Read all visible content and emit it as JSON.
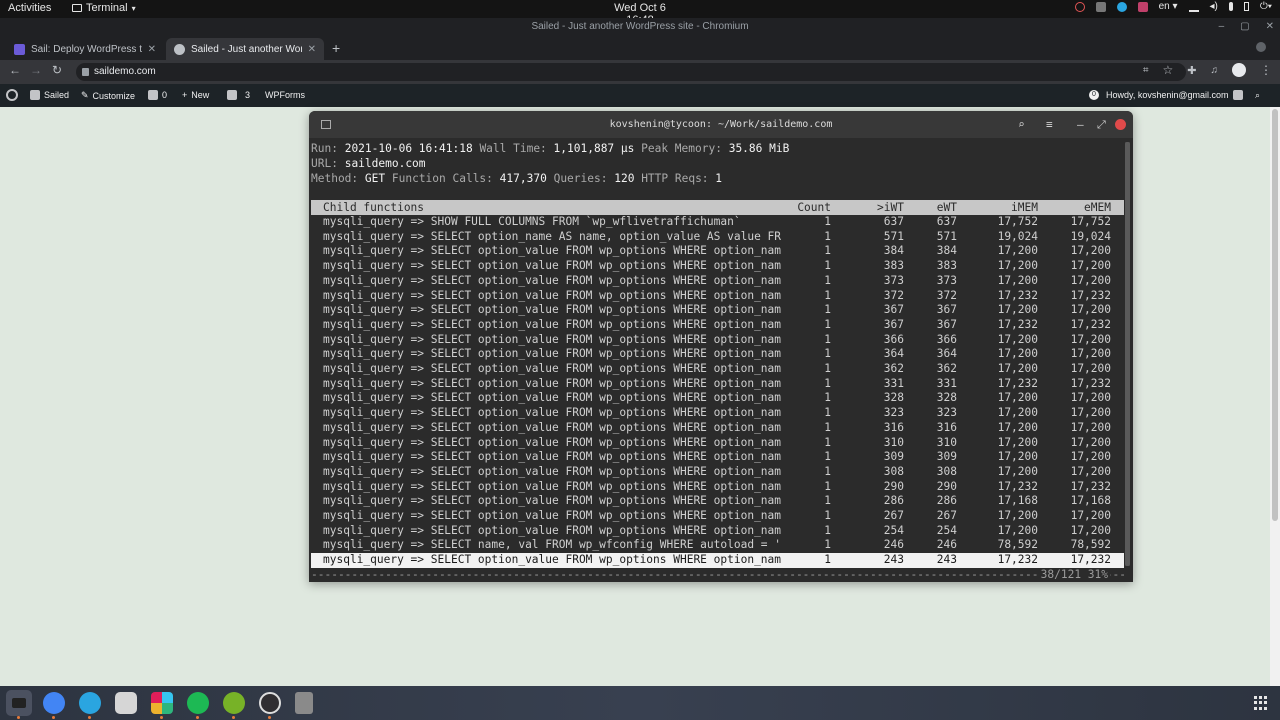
{
  "topbar": {
    "activities": "Activities",
    "app_menu": "Terminal",
    "clock": "Wed Oct 6  16:48",
    "input_source": "en"
  },
  "browser": {
    "window_title": "Sailed - Just another WordPress site - Chromium",
    "tabs": [
      {
        "label": "Sail: Deploy WordPress to",
        "active": false
      },
      {
        "label": "Sailed - Just another Wor",
        "active": true
      }
    ],
    "url": "saildemo.com"
  },
  "wp_admin_bar": {
    "site_name": "Sailed",
    "customize": "Customize",
    "comments_count": "0",
    "new": "New",
    "updates_count": "3",
    "wpforms": "WPForms",
    "notification_count": "0",
    "howdy": "Howdy, kovshenin@gmail.com"
  },
  "terminal": {
    "title": "kovshenin@tycoon: ~/Work/saildemo.com",
    "info": {
      "run_label": "Run:",
      "run": "2021-10-06 16:41:18",
      "wall_label": "Wall Time:",
      "wall": "1,101,887 μs",
      "peak_label": "Peak Memory:",
      "peak": "35.86 MiB",
      "url_label": "URL:",
      "url": "saildemo.com",
      "method_label": "Method:",
      "method": "GET",
      "calls_label": "Function Calls:",
      "calls": "417,370",
      "queries_label": "Queries:",
      "queries": "120",
      "http_label": "HTTP Reqs:",
      "http": "1"
    },
    "columns": {
      "fn": "Child functions",
      "count": "Count",
      "iwt": ">iWT",
      "ewt": "eWT",
      "imem": "iMEM",
      "emem": "eMEM"
    },
    "rows": [
      {
        "fn": "mysqli_query => SHOW FULL COLUMNS FROM `wp_wflivetraffichuman`",
        "count": "1",
        "iwt": "637",
        "ewt": "637",
        "imem": "17,752",
        "emem": "17,752"
      },
      {
        "fn": "mysqli_query => SELECT option_name AS name, option_value AS value FR",
        "count": "1",
        "iwt": "571",
        "ewt": "571",
        "imem": "19,024",
        "emem": "19,024"
      },
      {
        "fn": "mysqli_query => SELECT option_value FROM wp_options WHERE option_nam",
        "count": "1",
        "iwt": "384",
        "ewt": "384",
        "imem": "17,200",
        "emem": "17,200"
      },
      {
        "fn": "mysqli_query => SELECT option_value FROM wp_options WHERE option_nam",
        "count": "1",
        "iwt": "383",
        "ewt": "383",
        "imem": "17,200",
        "emem": "17,200"
      },
      {
        "fn": "mysqli_query => SELECT option_value FROM wp_options WHERE option_nam",
        "count": "1",
        "iwt": "373",
        "ewt": "373",
        "imem": "17,200",
        "emem": "17,200"
      },
      {
        "fn": "mysqli_query => SELECT option_value FROM wp_options WHERE option_nam",
        "count": "1",
        "iwt": "372",
        "ewt": "372",
        "imem": "17,232",
        "emem": "17,232"
      },
      {
        "fn": "mysqli_query => SELECT option_value FROM wp_options WHERE option_nam",
        "count": "1",
        "iwt": "367",
        "ewt": "367",
        "imem": "17,200",
        "emem": "17,200"
      },
      {
        "fn": "mysqli_query => SELECT option_value FROM wp_options WHERE option_nam",
        "count": "1",
        "iwt": "367",
        "ewt": "367",
        "imem": "17,232",
        "emem": "17,232"
      },
      {
        "fn": "mysqli_query => SELECT option_value FROM wp_options WHERE option_nam",
        "count": "1",
        "iwt": "366",
        "ewt": "366",
        "imem": "17,200",
        "emem": "17,200"
      },
      {
        "fn": "mysqli_query => SELECT option_value FROM wp_options WHERE option_nam",
        "count": "1",
        "iwt": "364",
        "ewt": "364",
        "imem": "17,200",
        "emem": "17,200"
      },
      {
        "fn": "mysqli_query => SELECT option_value FROM wp_options WHERE option_nam",
        "count": "1",
        "iwt": "362",
        "ewt": "362",
        "imem": "17,200",
        "emem": "17,200"
      },
      {
        "fn": "mysqli_query => SELECT option_value FROM wp_options WHERE option_nam",
        "count": "1",
        "iwt": "331",
        "ewt": "331",
        "imem": "17,232",
        "emem": "17,232"
      },
      {
        "fn": "mysqli_query => SELECT option_value FROM wp_options WHERE option_nam",
        "count": "1",
        "iwt": "328",
        "ewt": "328",
        "imem": "17,200",
        "emem": "17,200"
      },
      {
        "fn": "mysqli_query => SELECT option_value FROM wp_options WHERE option_nam",
        "count": "1",
        "iwt": "323",
        "ewt": "323",
        "imem": "17,200",
        "emem": "17,200"
      },
      {
        "fn": "mysqli_query => SELECT option_value FROM wp_options WHERE option_nam",
        "count": "1",
        "iwt": "316",
        "ewt": "316",
        "imem": "17,200",
        "emem": "17,200"
      },
      {
        "fn": "mysqli_query => SELECT option_value FROM wp_options WHERE option_nam",
        "count": "1",
        "iwt": "310",
        "ewt": "310",
        "imem": "17,200",
        "emem": "17,200"
      },
      {
        "fn": "mysqli_query => SELECT option_value FROM wp_options WHERE option_nam",
        "count": "1",
        "iwt": "309",
        "ewt": "309",
        "imem": "17,200",
        "emem": "17,200"
      },
      {
        "fn": "mysqli_query => SELECT option_value FROM wp_options WHERE option_nam",
        "count": "1",
        "iwt": "308",
        "ewt": "308",
        "imem": "17,200",
        "emem": "17,200"
      },
      {
        "fn": "mysqli_query => SELECT option_value FROM wp_options WHERE option_nam",
        "count": "1",
        "iwt": "290",
        "ewt": "290",
        "imem": "17,232",
        "emem": "17,232"
      },
      {
        "fn": "mysqli_query => SELECT option_value FROM wp_options WHERE option_nam",
        "count": "1",
        "iwt": "286",
        "ewt": "286",
        "imem": "17,168",
        "emem": "17,168"
      },
      {
        "fn": "mysqli_query => SELECT option_value FROM wp_options WHERE option_nam",
        "count": "1",
        "iwt": "267",
        "ewt": "267",
        "imem": "17,200",
        "emem": "17,200"
      },
      {
        "fn": "mysqli_query => SELECT option_value FROM wp_options WHERE option_nam",
        "count": "1",
        "iwt": "254",
        "ewt": "254",
        "imem": "17,200",
        "emem": "17,200"
      },
      {
        "fn": "mysqli_query => SELECT name, val FROM wp_wfconfig WHERE autoload = '",
        "count": "1",
        "iwt": "246",
        "ewt": "246",
        "imem": "78,592",
        "emem": "78,592"
      },
      {
        "fn": "mysqli_query => SELECT option_value FROM wp_options WHERE option_nam",
        "count": "1",
        "iwt": "243",
        "ewt": "243",
        "imem": "17,232",
        "emem": "17,232"
      }
    ],
    "selected_row": 23,
    "status_dashes": "--------------------------------------------------------------------------------------------------------------------------------------------------------------------------------",
    "status_position": "38/121 31%"
  },
  "colors": {
    "terminal_bg": "#2b2b2b",
    "header_bg": "#c7c7c7",
    "selected_bg": "#f2f2f2",
    "page_bg": "#dfe8df",
    "close_red": "#e04a4a"
  },
  "dock": [
    "terminal-icon",
    "chromium-icon",
    "telegram-icon",
    "files-icon",
    "slack-icon",
    "spotify-icon",
    "yoast-icon",
    "obs-icon",
    "trash-icon"
  ]
}
